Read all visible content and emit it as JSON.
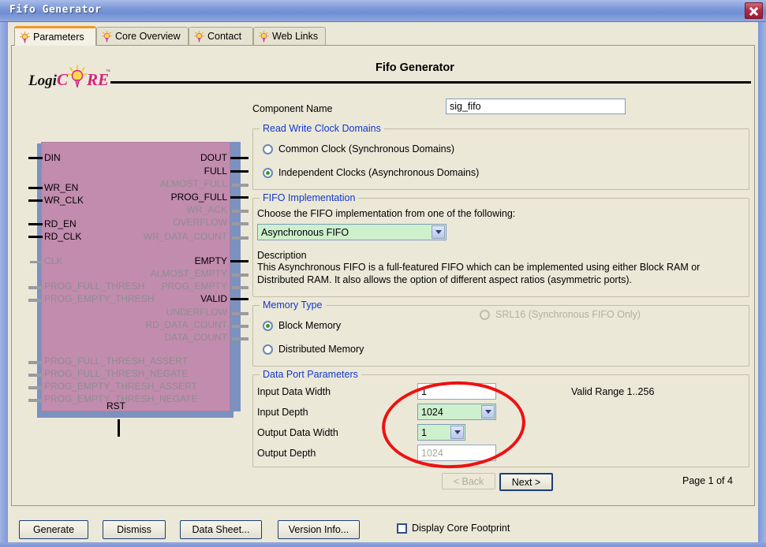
{
  "window": {
    "title": "Fifo Generator",
    "close_icon": "close-icon"
  },
  "tabs": [
    {
      "label": "Parameters",
      "icon": "lightbulb-icon",
      "active": true
    },
    {
      "label": "Core Overview",
      "icon": "lightbulb-icon",
      "active": false
    },
    {
      "label": "Contact",
      "icon": "lightbulb-icon",
      "active": false
    },
    {
      "label": "Web Links",
      "icon": "lightbulb-icon",
      "active": false
    }
  ],
  "header": {
    "page_title": "Fifo Generator",
    "logo_text_1": "Logi",
    "logo_text_2": "C",
    "logo_text_3": "RE"
  },
  "diagram": {
    "inputs_active": [
      "DIN",
      "WR_EN",
      "WR_CLK",
      "RD_EN",
      "RD_CLK"
    ],
    "inputs_inactive": [
      "CLK",
      "PROG_FULL_THRESH",
      "PROG_EMPTY_THRESH",
      "PROG_FULL_THRESH_ASSERT",
      "PROG_FULL_THRESH_NEGATE",
      "PROG_EMPTY_THRESH_ASSERT",
      "PROG_EMPTY_THRESH_NEGATE"
    ],
    "outputs_active": [
      "DOUT",
      "FULL",
      "PROG_FULL",
      "EMPTY",
      "VALID"
    ],
    "outputs_inactive": [
      "ALMOST_FULL",
      "WR_ACK",
      "OVERFLOW",
      "WR_DATA_COUNT",
      "ALMOST_EMPTY",
      "PROG_EMPTY",
      "UNDERFLOW",
      "RD_DATA_COUNT",
      "DATA_COUNT"
    ],
    "reset_pin": "RST"
  },
  "component": {
    "label": "Component Name",
    "value": "sig_fifo",
    "placeholder": ""
  },
  "clock_domains": {
    "group_title": "Read Write Clock Domains",
    "options": [
      {
        "label": "Common Clock (Synchronous Domains)",
        "selected": false
      },
      {
        "label": "Independent Clocks (Asynchronous Domains)",
        "selected": true
      }
    ]
  },
  "fifo_implementation": {
    "group_title": "FIFO Implementation",
    "prompt": "Choose the FIFO implementation from one of the following:",
    "selected": "Asynchronous FIFO",
    "description_label": "Description",
    "description_line1": "This Asynchronous FIFO is a full-featured FIFO which can be implemented using either Block RAM or",
    "description_line2": "Distributed RAM. It also allows the option of different aspect ratios (asymmetric ports)."
  },
  "memory_type": {
    "group_title": "Memory Type",
    "options": [
      {
        "label": "Block Memory",
        "selected": true,
        "disabled": false
      },
      {
        "label": "Distributed Memory",
        "selected": false,
        "disabled": false
      },
      {
        "label": "SRL16 (Synchronous FIFO Only)",
        "selected": false,
        "disabled": true
      }
    ]
  },
  "data_port_parameters": {
    "group_title": "Data Port Parameters",
    "valid_range": "Valid Range 1..256",
    "fields": [
      {
        "label": "Input Data Width",
        "value": "1",
        "type": "text",
        "disabled": false
      },
      {
        "label": "Input Depth",
        "value": "1024",
        "type": "select",
        "disabled": false
      },
      {
        "label": "Output Data Width",
        "value": "1",
        "type": "select",
        "disabled": false
      },
      {
        "label": "Output Depth",
        "value": "1024",
        "type": "text",
        "disabled": true
      }
    ]
  },
  "navigation": {
    "back_label": "< Back",
    "next_label": "Next >",
    "page_indicator": "Page 1 of 4"
  },
  "toolbar": {
    "generate_label": "Generate",
    "dismiss_label": "Dismiss",
    "datasheet_label": "Data Sheet...",
    "versioninfo_label": "Version Info...",
    "footprint_label": "Display Core Footprint",
    "footprint_checked": false
  },
  "colors": {
    "titlebar": "#7e9ad8",
    "panel_bg": "#ebe8d8",
    "group_title": "#1437c9",
    "block_fill": "#c28cae",
    "block_shadow": "#7b91c0",
    "select_bg": "#cdf0cd",
    "annotation": "#ee1111",
    "tab_active_top": "#f0962b"
  }
}
